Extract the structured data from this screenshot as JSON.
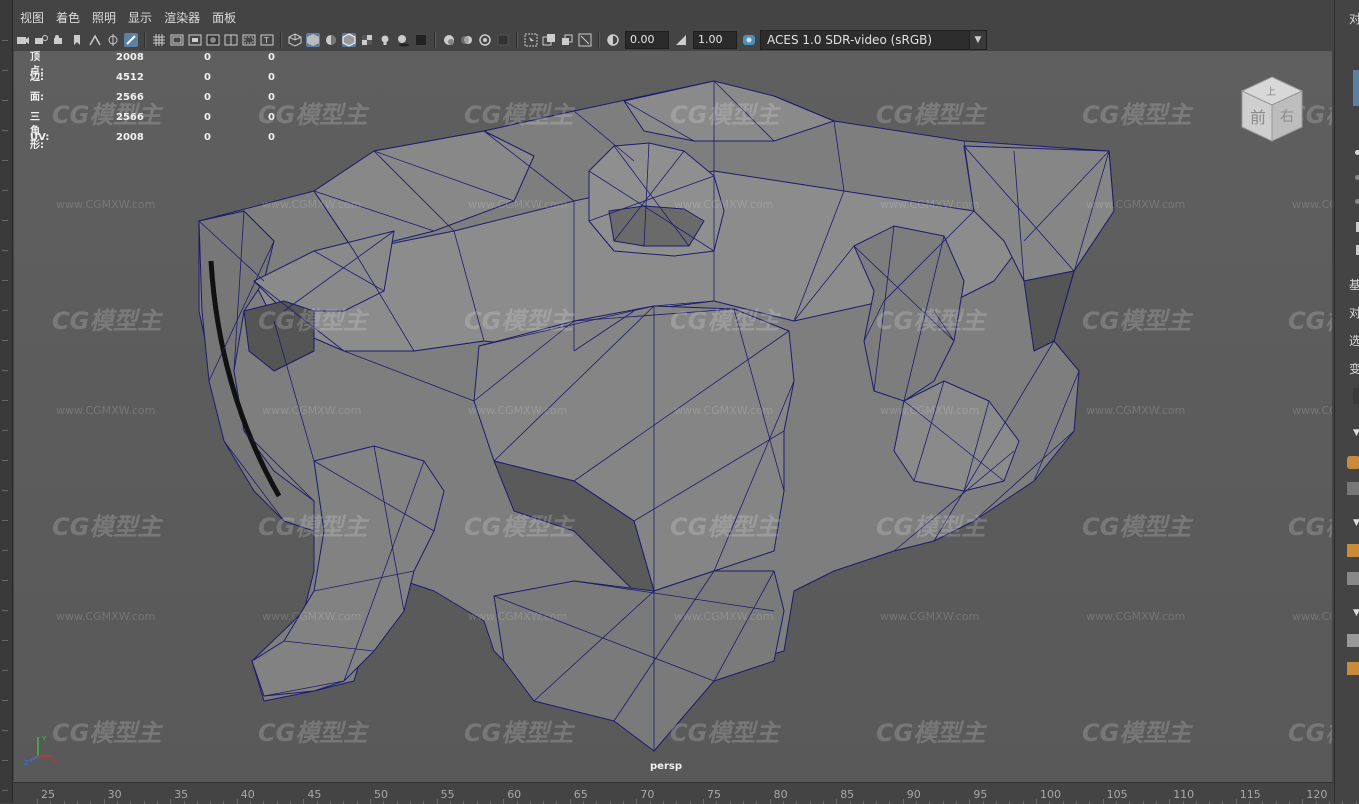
{
  "menu": [
    "视图",
    "着色",
    "照明",
    "显示",
    "渲染器",
    "面板"
  ],
  "toolbar": {
    "exposure": "0.00",
    "gamma": "1.00",
    "color_space": "ACES 1.0 SDR-video (sRGB)"
  },
  "hud": {
    "rows": [
      {
        "label": "顶点:",
        "v1": "2008",
        "v2": "0",
        "v3": "0"
      },
      {
        "label": "边:",
        "v1": "4512",
        "v2": "0",
        "v3": "0"
      },
      {
        "label": "面:",
        "v1": "2566",
        "v2": "0",
        "v3": "0"
      },
      {
        "label": "三角形:",
        "v1": "2566",
        "v2": "0",
        "v3": "0"
      },
      {
        "label": "UV:",
        "v1": "2008",
        "v2": "0",
        "v3": "0"
      }
    ]
  },
  "viewcube": {
    "top": "上",
    "front": "前",
    "right": "右"
  },
  "camera_label": "persp",
  "watermark": {
    "logo": "CG模型主",
    "url": "www.CGMXW.com"
  },
  "right_panel": [
    "对",
    "基",
    "对",
    "选",
    "变"
  ],
  "ruler": [
    "25",
    "30",
    "35",
    "40",
    "45",
    "50",
    "55",
    "60",
    "65",
    "70",
    "75",
    "80",
    "85",
    "90",
    "95",
    "100",
    "105",
    "110",
    "115",
    "120"
  ],
  "colors": {
    "viewport_bg": "#5d5d5d",
    "wire": "#1c1c6e",
    "mesh": "#808080",
    "active": "#5c7fa3"
  }
}
